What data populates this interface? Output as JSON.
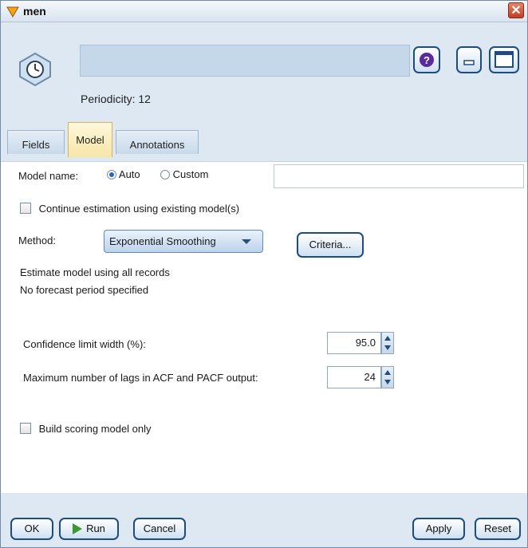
{
  "window": {
    "title": "men"
  },
  "header": {
    "periodicity_text": "Periodicity: 12"
  },
  "tabs": [
    {
      "label": "Fields"
    },
    {
      "label": "Model"
    },
    {
      "label": "Annotations"
    }
  ],
  "model": {
    "model_name_label": "Model name:",
    "auto_label": "Auto",
    "custom_label": "Custom",
    "model_name_value": "",
    "continue_label": "Continue estimation using existing model(s)",
    "method_label": "Method:",
    "method_value": "Exponential Smoothing",
    "criteria_label": "Criteria...",
    "info_line1": "Estimate model using all records",
    "info_line2": "No forecast period specified",
    "confidence_label": "Confidence limit width (%):",
    "confidence_value": "95.0",
    "lags_label": "Maximum number of lags in ACF and PACF output:",
    "lags_value": "24",
    "scoring_label": "Build scoring model only"
  },
  "footer": {
    "ok": "OK",
    "run": "Run",
    "cancel": "Cancel",
    "apply": "Apply",
    "reset": "Reset"
  },
  "colors": {
    "accent": "#1d4d80",
    "panel": "#dde8f3",
    "active_tab": "#f7e6a7",
    "run_icon": "#3b9a2f"
  }
}
